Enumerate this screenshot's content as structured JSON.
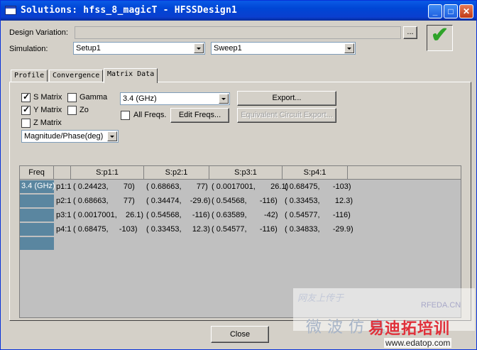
{
  "window": {
    "title": "Solutions: hfss_8_magicT - HFSSDesign1"
  },
  "design_variation": {
    "label": "Design Variation:",
    "value": "",
    "browse_label": "..."
  },
  "simulation": {
    "label": "Simulation:",
    "setup": "Setup1",
    "sweep": "Sweep1"
  },
  "tabs": [
    {
      "label": "Profile"
    },
    {
      "label": "Convergence"
    },
    {
      "label": "Matrix Data"
    }
  ],
  "matrix_options": {
    "s_matrix": {
      "label": "S Matrix",
      "checked": true
    },
    "y_matrix": {
      "label": "Y Matrix",
      "checked": true
    },
    "z_matrix": {
      "label": "Z Matrix",
      "checked": false
    },
    "gamma": {
      "label": "Gamma",
      "checked": false
    },
    "zo": {
      "label": "Zo",
      "checked": false
    },
    "display_format": "Magnitude/Phase(deg)"
  },
  "frequency": {
    "selected": "3.4 (GHz)",
    "all_freqs_label": "All Freqs.",
    "all_freqs_checked": false,
    "edit_freqs_label": "Edit Freqs..."
  },
  "buttons": {
    "export": "Export...",
    "equivalent_circuit_export": "Equivalent Circuit Export...",
    "close": "Close"
  },
  "grid": {
    "headers": [
      "Freq",
      "",
      "S:p1:1",
      "S:p2:1",
      "S:p3:1",
      "S:p4:1"
    ],
    "freq_value": "3.4 (GHz)",
    "rows": [
      {
        "label": "p1:1",
        "cells": [
          "( 0.24423,       70)",
          "( 0.68663,       77)",
          "( 0.0017001,       26.1)",
          "( 0.68475,      -103)"
        ]
      },
      {
        "label": "p2:1",
        "cells": [
          "( 0.68663,       77)",
          "( 0.34474,    -29.6)",
          "( 0.54568,      -116)",
          "( 0.33453,       12.3)"
        ]
      },
      {
        "label": "p3:1",
        "cells": [
          "( 0.0017001,    26.1)",
          "( 0.54568,     -116)",
          "( 0.63589,        -42)",
          "( 0.54577,      -116)"
        ]
      },
      {
        "label": "p4:1",
        "cells": [
          "( 0.68475,     -103)",
          "( 0.33453,     12.3)",
          "( 0.54577,      -116)",
          "( 0.34833,      -29.9)"
        ]
      }
    ]
  },
  "watermark": {
    "site_text": "网友上传于",
    "rfeda": "RFEDA.CN",
    "chinese": "微波仿真",
    "brand": "易迪拓培训",
    "url": "www.edatop.com"
  },
  "colors": {
    "title_bar": "#0046d5",
    "freq_cell": "#5a86a0",
    "grid_bg": "#c0c0c0",
    "ok_check": "#2fa32a"
  }
}
